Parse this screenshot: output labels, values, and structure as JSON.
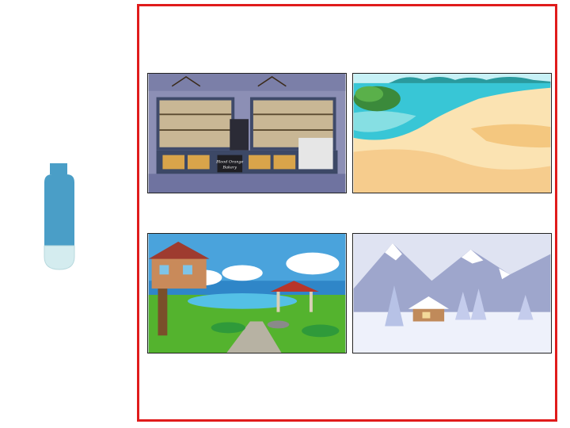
{
  "colors": {
    "frame_border": "#e01b1b",
    "bottle_cap": "#4a9ec7",
    "bottle_body": "#4a9ec7",
    "bottle_bottom": "#d4ecef"
  },
  "choices": [
    {
      "name": "bakery-scene",
      "text_sign": "Blood Orange Bakery"
    },
    {
      "name": "beach-scene"
    },
    {
      "name": "treehouse-park-scene"
    },
    {
      "name": "snowy-mountain-scene"
    }
  ]
}
